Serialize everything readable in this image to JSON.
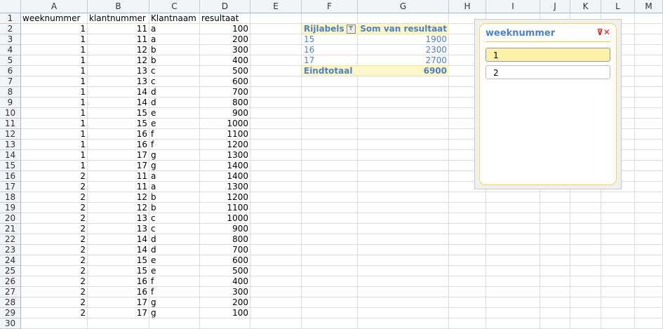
{
  "columns": [
    "A",
    "B",
    "C",
    "D",
    "E",
    "F",
    "G",
    "H",
    "I",
    "J",
    "K",
    "L",
    "M"
  ],
  "headers": [
    "weeknummer",
    "klantnummer",
    "Klantnaam",
    "resultaat"
  ],
  "rows": [
    [
      1,
      11,
      "a",
      100
    ],
    [
      1,
      11,
      "a",
      200
    ],
    [
      1,
      12,
      "b",
      300
    ],
    [
      1,
      12,
      "b",
      400
    ],
    [
      1,
      13,
      "c",
      500
    ],
    [
      1,
      13,
      "c",
      600
    ],
    [
      1,
      14,
      "d",
      700
    ],
    [
      1,
      14,
      "d",
      800
    ],
    [
      1,
      15,
      "e",
      900
    ],
    [
      1,
      15,
      "e",
      1000
    ],
    [
      1,
      16,
      "f",
      1100
    ],
    [
      1,
      16,
      "f",
      1200
    ],
    [
      1,
      17,
      "g",
      1300
    ],
    [
      1,
      17,
      "g",
      1400
    ],
    [
      2,
      11,
      "a",
      1400
    ],
    [
      2,
      11,
      "a",
      1300
    ],
    [
      2,
      12,
      "b",
      1200
    ],
    [
      2,
      12,
      "b",
      1100
    ],
    [
      2,
      13,
      "c",
      1000
    ],
    [
      2,
      13,
      "c",
      900
    ],
    [
      2,
      14,
      "d",
      800
    ],
    [
      2,
      14,
      "d",
      700
    ],
    [
      2,
      15,
      "e",
      600
    ],
    [
      2,
      15,
      "e",
      500
    ],
    [
      2,
      16,
      "f",
      400
    ],
    [
      2,
      16,
      "f",
      300
    ],
    [
      2,
      17,
      "g",
      200
    ],
    [
      2,
      17,
      "g",
      100
    ]
  ],
  "pivot": {
    "row_label": "Rijlabels",
    "value_label": "Som van resultaat",
    "rows": [
      {
        "label": "15",
        "value": "1900"
      },
      {
        "label": "16",
        "value": "2300"
      },
      {
        "label": "17",
        "value": "2700"
      }
    ],
    "total_label": "Eindtotaal",
    "total_value": "6900"
  },
  "slicer": {
    "title": "weeknummer",
    "items": [
      {
        "label": "1",
        "selected": true
      },
      {
        "label": "2",
        "selected": false
      }
    ]
  }
}
